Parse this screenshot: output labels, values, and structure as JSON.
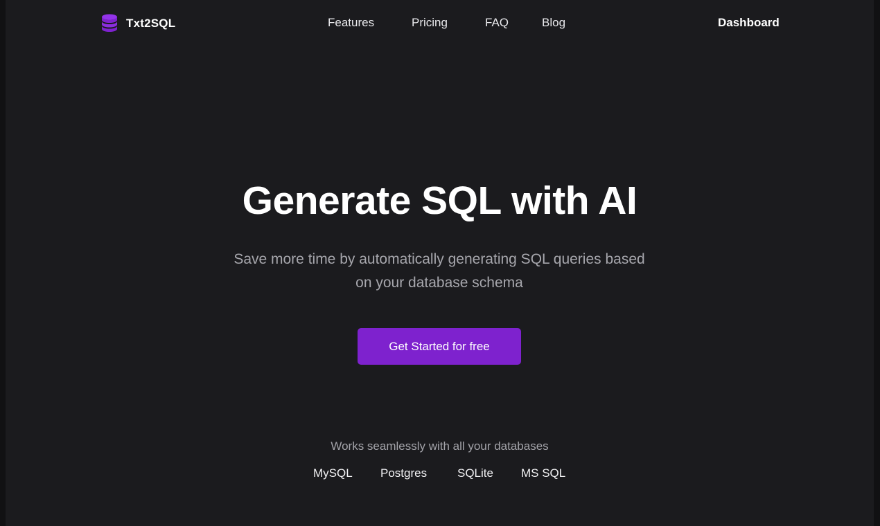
{
  "header": {
    "brand_name": "Txt2SQL",
    "brand_icon": "database-icon",
    "nav": {
      "features": "Features",
      "pricing": "Pricing",
      "faq": "FAQ",
      "blog": "Blog"
    },
    "dashboard_label": "Dashboard"
  },
  "hero": {
    "title": "Generate SQL with AI",
    "subtitle": "Save more time by automatically generating SQL queries based on your database schema",
    "cta_label": "Get Started for free"
  },
  "databases": {
    "caption": "Works seamlessly with all your databases",
    "items": [
      "MySQL",
      "Postgres",
      "SQLite",
      "MS SQL"
    ]
  },
  "colors": {
    "background": "#1b1b1e",
    "accent": "#7e22ce",
    "muted_text": "#a7a7ad"
  }
}
